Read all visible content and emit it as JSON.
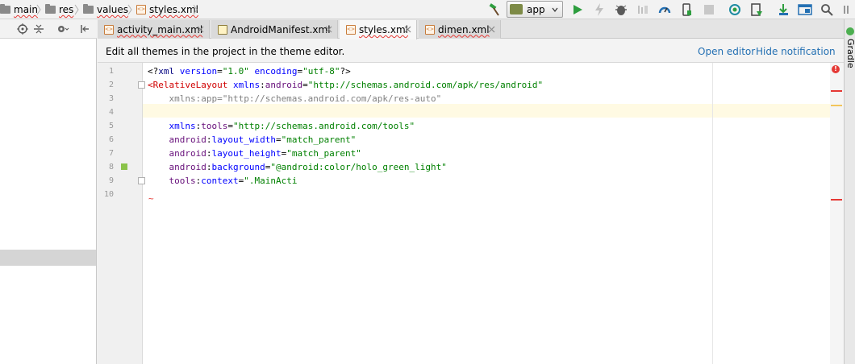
{
  "breadcrumb": {
    "items": [
      {
        "label": "main"
      },
      {
        "label": "res"
      },
      {
        "label": "values"
      },
      {
        "label": "styles.xml"
      }
    ]
  },
  "toolbar": {
    "run_config_label": "app",
    "icons": [
      "build-hammer-icon",
      "run-icon",
      "apply-changes-icon",
      "debug-icon",
      "attach-debugger-icon",
      "profiler-icon",
      "device-manager-icon",
      "stop-icon",
      "sync-icon",
      "sdk-manager-icon",
      "download-icon",
      "project-structure-icon",
      "search-icon"
    ],
    "colors": {
      "run": "#2e9e3f",
      "hammer": "#2e9e3f",
      "accent": "#2470b3"
    }
  },
  "tabs": [
    {
      "label": "activity_main.xml",
      "active": false
    },
    {
      "label": "AndroidManifest.xml",
      "active": false
    },
    {
      "label": "styles.xml",
      "active": true
    },
    {
      "label": "dimen.xml",
      "active": false
    }
  ],
  "notification": {
    "message": "Edit all themes in the project in the theme editor.",
    "open_editor": "Open editor",
    "hide_notification": "Hide notification"
  },
  "editor": {
    "line_numbers": [
      "1",
      "2",
      "3",
      "4",
      "5",
      "6",
      "7",
      "8",
      "9",
      "10"
    ],
    "lines": [
      [
        {
          "t": "pi",
          "v": "<?"
        },
        {
          "t": "tagname",
          "v": "xml "
        },
        {
          "t": "attr",
          "v": "version"
        },
        {
          "t": "pi",
          "v": "="
        },
        {
          "t": "str",
          "v": "\"1.0\" "
        },
        {
          "t": "attr",
          "v": "encoding"
        },
        {
          "t": "pi",
          "v": "="
        },
        {
          "t": "str",
          "v": "\"utf-8\""
        },
        {
          "t": "pi",
          "v": "?>"
        }
      ],
      [
        {
          "t": "err",
          "v": "<RelativeLayout "
        },
        {
          "t": "attr",
          "v": "xmlns"
        },
        {
          "t": "pi",
          "v": ":"
        },
        {
          "t": "ns",
          "v": "android"
        },
        {
          "t": "pi",
          "v": "="
        },
        {
          "t": "str",
          "v": "\"http://schemas.android.com/apk/res/android\""
        }
      ],
      [
        {
          "t": "dim",
          "v": "    xmlns:app=\"http://schemas.android.com/apk/res-auto\""
        }
      ],
      [],
      [
        {
          "t": "attr",
          "v": "    xmlns"
        },
        {
          "t": "pi",
          "v": ":"
        },
        {
          "t": "ns",
          "v": "tools"
        },
        {
          "t": "pi",
          "v": "="
        },
        {
          "t": "str",
          "v": "\"http://schemas.android.com/tools\""
        }
      ],
      [
        {
          "t": "ns",
          "v": "    android"
        },
        {
          "t": "pi",
          "v": ":"
        },
        {
          "t": "attr",
          "v": "layout_width"
        },
        {
          "t": "pi",
          "v": "="
        },
        {
          "t": "str",
          "v": "\"match_parent\""
        }
      ],
      [
        {
          "t": "ns",
          "v": "    android"
        },
        {
          "t": "pi",
          "v": ":"
        },
        {
          "t": "attr",
          "v": "layout_height"
        },
        {
          "t": "pi",
          "v": "="
        },
        {
          "t": "str",
          "v": "\"match_parent\""
        }
      ],
      [
        {
          "t": "ns",
          "v": "    android"
        },
        {
          "t": "pi",
          "v": ":"
        },
        {
          "t": "attr",
          "v": "background"
        },
        {
          "t": "pi",
          "v": "="
        },
        {
          "t": "str",
          "v": "\"@android:color/holo_green_light\""
        }
      ],
      [
        {
          "t": "ns",
          "v": "    tools"
        },
        {
          "t": "pi",
          "v": ":"
        },
        {
          "t": "attr",
          "v": "context"
        },
        {
          "t": "pi",
          "v": "="
        },
        {
          "t": "str",
          "v": "\".MainActi"
        }
      ],
      []
    ],
    "color_swatch": "#8bc34a"
  },
  "sidebar_right": {
    "gradle_label": "Gradle"
  },
  "error_stripe": {
    "indicator": "!",
    "color": "#e53935"
  }
}
